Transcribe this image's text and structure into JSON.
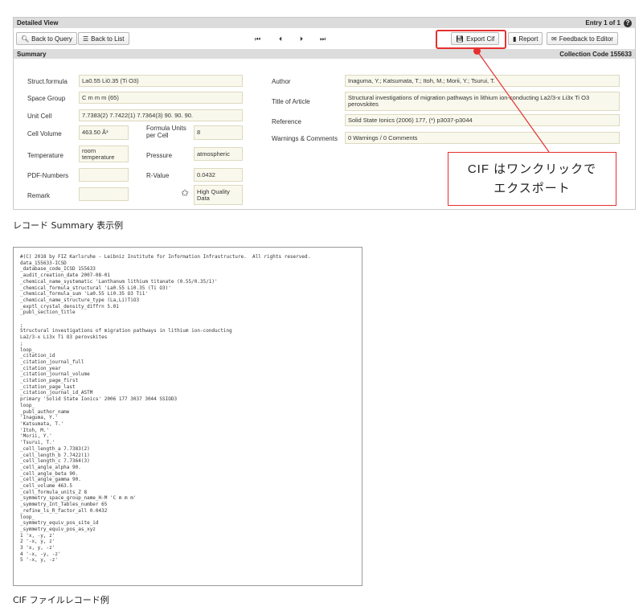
{
  "panel": {
    "title": "Detailed View",
    "entry": "Entry 1 of 1",
    "help_glyph": "?",
    "toolbar": {
      "back_query": "Back to Query",
      "back_list": "Back to List",
      "nav_first": "⏮",
      "nav_prev": "⏴",
      "nav_next": "⏵",
      "nav_last": "⏭",
      "export_cif": "Export Cif",
      "report": "Report",
      "feedback": "Feedback to Editor"
    },
    "summary": {
      "title": "Summary",
      "collection_code": "Collection Code 155633",
      "struct_formula_label": "Struct.formula",
      "struct_formula": "La0.55 Li0.35 (Ti O3)",
      "space_group_label": "Space Group",
      "space_group": "C m m m (65)",
      "unit_cell_label": "Unit Cell",
      "unit_cell": "7.7383(2) 7.7422(1) 7.7364(3) 90. 90. 90.",
      "cell_volume_label": "Cell Volume",
      "cell_volume": "463.50 Å³",
      "formula_units_label": "Formula Units per Cell",
      "formula_units": "8",
      "temperature_label": "Temperature",
      "temperature": "room temperature",
      "pressure_label": "Pressure",
      "pressure": "atmospheric",
      "pdf_label": "PDF-Numbers",
      "pdf": "",
      "rvalue_label": "R-Value",
      "rvalue": "0.0432",
      "remark_label": "Remark",
      "remark": "",
      "quality": "High Quality Data",
      "author_label": "Author",
      "author": "Inaguma, Y.; Katsumata, T.; Itoh, M.; Morii, Y.; Tsurui, T.",
      "article_label": "Title of Article",
      "article": "Structural investigations of migration pathways in lithium ion-conducting La2/3-x Li3x Ti O3 perovskites",
      "reference_label": "Reference",
      "reference": "Solid State Ionics (2006) 177, (*) p3037-p3044",
      "warnings_label": "Warnings & Comments",
      "warnings": "0 Warnings / 0 Comments"
    }
  },
  "callout": {
    "line1": "CIF はワンクリックで",
    "line2": "エクスポート",
    "color": "#e53030"
  },
  "captions": {
    "summary": "レコード Summary 表示例",
    "cif": "CIF ファイルレコード例"
  },
  "cif_text": "#(C) 2018 by FIZ Karlsruhe - Leibniz Institute for Information Infrastructure.  All rights reserved.\ndata_155633-ICSD\n_database_code_ICSD 155633\n_audit_creation_date 2007-08-01\n_chemical_name_systematic 'Lanthanum lithium titanate (0.55/0.35/1)'\n_chemical_formula_structural 'La0.55 Li0.35 (Ti O3)'\n_chemical_formula_sum 'La0.55 Li0.35 O3 Ti1'\n_chemical_name_structure_type (La,Li)TiO3\n_exptl_crystal_density_diffrn 5.01\n_publ_section_title\n\n;\nStructural investigations of migration pathways in lithium ion-conducting\nLa2/3-x Li3x Ti O3 perovskites\n;\nloop_\n_citation_id\n_citation_journal_full\n_citation_year\n_citation_journal_volume\n_citation_page_first\n_citation_page_last\n_citation_journal_id_ASTM\nprimary 'Solid State Ionics' 2006 177 3037 3044 SSIOD3\nloop_\n_publ_author_name\n'Inaguma, Y.'\n'Katsumata, T.'\n'Itoh, M.'\n'Morii, Y.'\n'Tsurui, T.'\n_cell_length_a 7.7383(2)\n_cell_length_b 7.7422(1)\n_cell_length_c 7.7364(3)\n_cell_angle_alpha 90.\n_cell_angle_beta 90.\n_cell_angle_gamma 90.\n_cell_volume 463.5\n_cell_formula_units_Z 8\n_symmetry_space_group_name_H-M 'C m m m'\n_symmetry_Int_Tables_number 65\n_refine_ls_R_factor_all 0.0432\nloop_\n_symmetry_equiv_pos_site_id\n_symmetry_equiv_pos_as_xyz\n1 'x, -y, z'\n2 '-x, y, z'\n3 'x, y, -z'\n4 '-x, -y, -z'\n5 '-x, y, -z'"
}
